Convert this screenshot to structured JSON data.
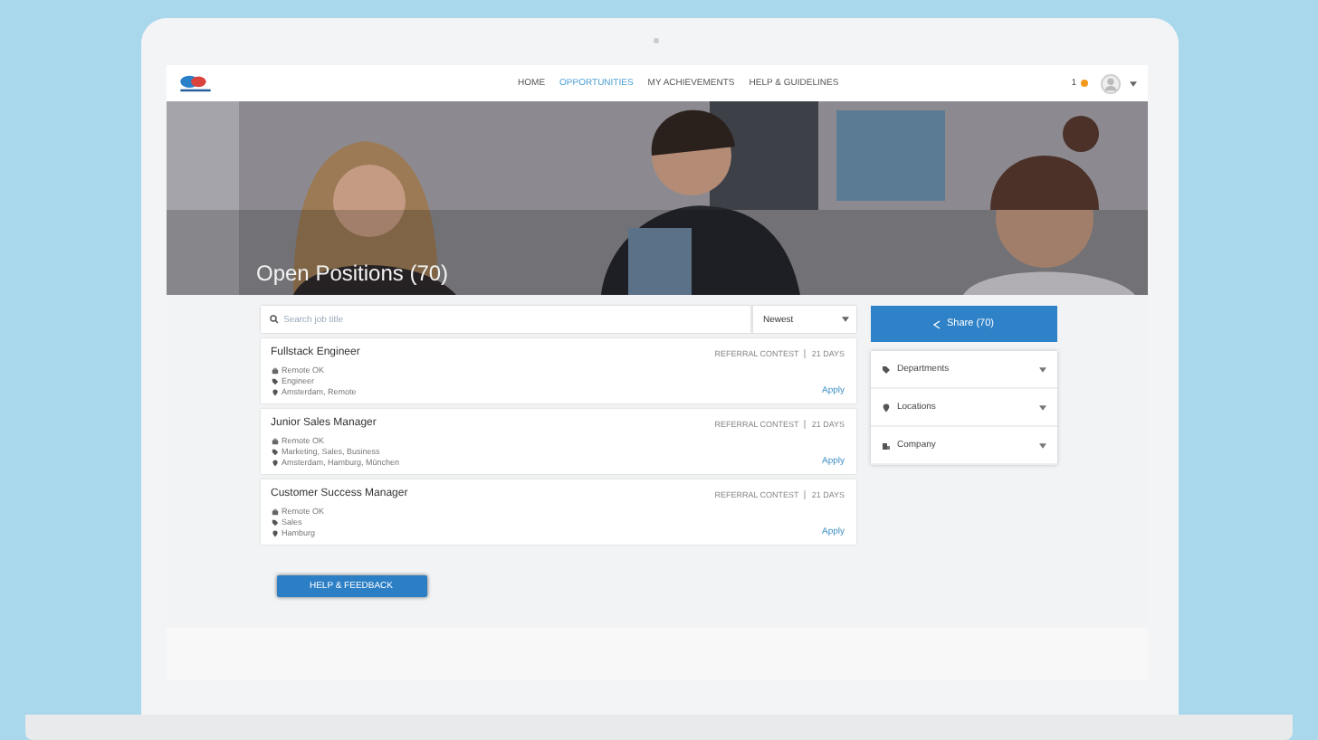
{
  "nav": {
    "links": [
      {
        "label": "HOME",
        "selected": false
      },
      {
        "label": "OPPORTUNITIES",
        "selected": true
      },
      {
        "label": "MY ACHIEVEMENTS",
        "selected": false
      },
      {
        "label": "HELP & GUIDELINES",
        "selected": false
      }
    ],
    "notifications": "1"
  },
  "hero": {
    "title": "Open Positions (70)"
  },
  "search": {
    "placeholder": "Search job title"
  },
  "sort": "Newest",
  "jobs": [
    {
      "title": "Fullstack Engineer",
      "meta_left": "REFERRAL CONTEST",
      "meta_right": "21 DAYS",
      "details": [
        {
          "kind": "work",
          "text": "Remote OK"
        },
        {
          "kind": "tag",
          "text": "Engineer"
        },
        {
          "kind": "place",
          "text": "Amsterdam, Remote"
        }
      ],
      "action": "Apply"
    },
    {
      "title": "Junior Sales Manager",
      "meta_left": "REFERRAL CONTEST",
      "meta_right": "21 DAYS",
      "details": [
        {
          "kind": "work",
          "text": "Remote OK"
        },
        {
          "kind": "tag",
          "text": "Marketing, Sales, Business"
        },
        {
          "kind": "place",
          "text": "Amsterdam, Hamburg, München"
        }
      ],
      "action": "Apply"
    },
    {
      "title": "Customer Success Manager",
      "meta_left": "REFERRAL CONTEST",
      "meta_right": "21 DAYS",
      "details": [
        {
          "kind": "work",
          "text": "Remote OK"
        },
        {
          "kind": "tag",
          "text": "Sales"
        },
        {
          "kind": "place",
          "text": "Hamburg"
        }
      ],
      "action": "Apply"
    }
  ],
  "share_button": "Share (70)",
  "filters": [
    {
      "label": "Departments",
      "kind": "tag",
      "expanded": false
    },
    {
      "label": "Locations",
      "kind": "place",
      "expanded": false
    },
    {
      "label": "Company",
      "kind": "company",
      "expanded": false
    }
  ],
  "help_button": "HELP & FEEDBACK"
}
